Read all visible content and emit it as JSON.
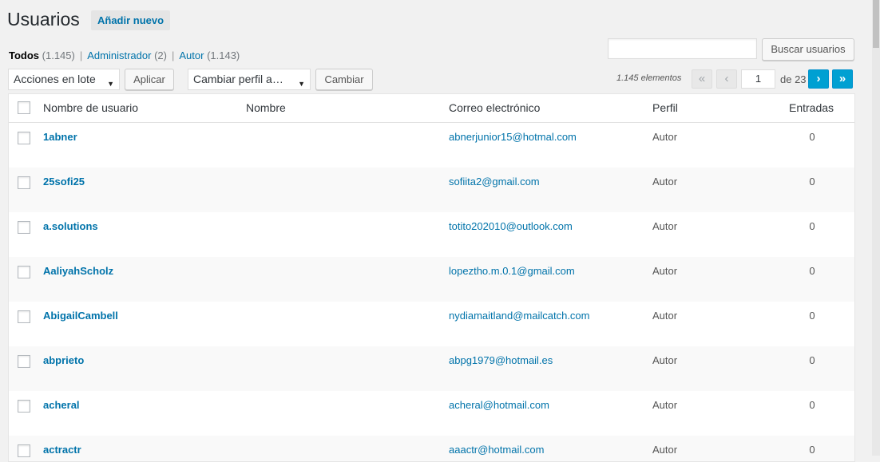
{
  "header": {
    "title": "Usuarios",
    "add_new": "Añadir nuevo"
  },
  "views": [
    {
      "label": "Todos",
      "count": "(1.145)"
    },
    {
      "label": "Administrador",
      "count": "(2)"
    },
    {
      "label": "Autor",
      "count": "(1.143)"
    }
  ],
  "search": {
    "value": "",
    "button": "Buscar usuarios"
  },
  "bulk": {
    "select": "Acciones en lote",
    "apply": "Aplicar"
  },
  "role_change": {
    "select": "Cambiar perfil a…",
    "button": "Cambiar"
  },
  "pagination": {
    "items": "1.145 elementos",
    "first": "«",
    "prev": "‹",
    "current": "1",
    "of": "de 23",
    "next": "›",
    "last": "»"
  },
  "table": {
    "headers": {
      "username": "Nombre de usuario",
      "name": "Nombre",
      "email": "Correo electrónico",
      "role": "Perfil",
      "posts": "Entradas"
    },
    "rows": [
      {
        "username": "1abner",
        "name": "",
        "email": "abnerjunior15@hotmal.com",
        "role": "Autor",
        "posts": "0"
      },
      {
        "username": "25sofi25",
        "name": "",
        "email": "sofiita2@gmail.com",
        "role": "Autor",
        "posts": "0"
      },
      {
        "username": "a.solutions",
        "name": "",
        "email": "totito202010@outlook.com",
        "role": "Autor",
        "posts": "0"
      },
      {
        "username": "AaliyahScholz",
        "name": "",
        "email": "lopeztho.m.0.1@gmail.com",
        "role": "Autor",
        "posts": "0"
      },
      {
        "username": "AbigailCambell",
        "name": "",
        "email": "nydiamaitland@mailcatch.com",
        "role": "Autor",
        "posts": "0"
      },
      {
        "username": "abprieto",
        "name": "",
        "email": "abpg1979@hotmail.es",
        "role": "Autor",
        "posts": "0"
      },
      {
        "username": "acheral",
        "name": "",
        "email": "acheral@hotmail.com",
        "role": "Autor",
        "posts": "0"
      },
      {
        "username": "actractr",
        "name": "",
        "email": "aaactr@hotmail.com",
        "role": "Autor",
        "posts": "0"
      }
    ]
  }
}
